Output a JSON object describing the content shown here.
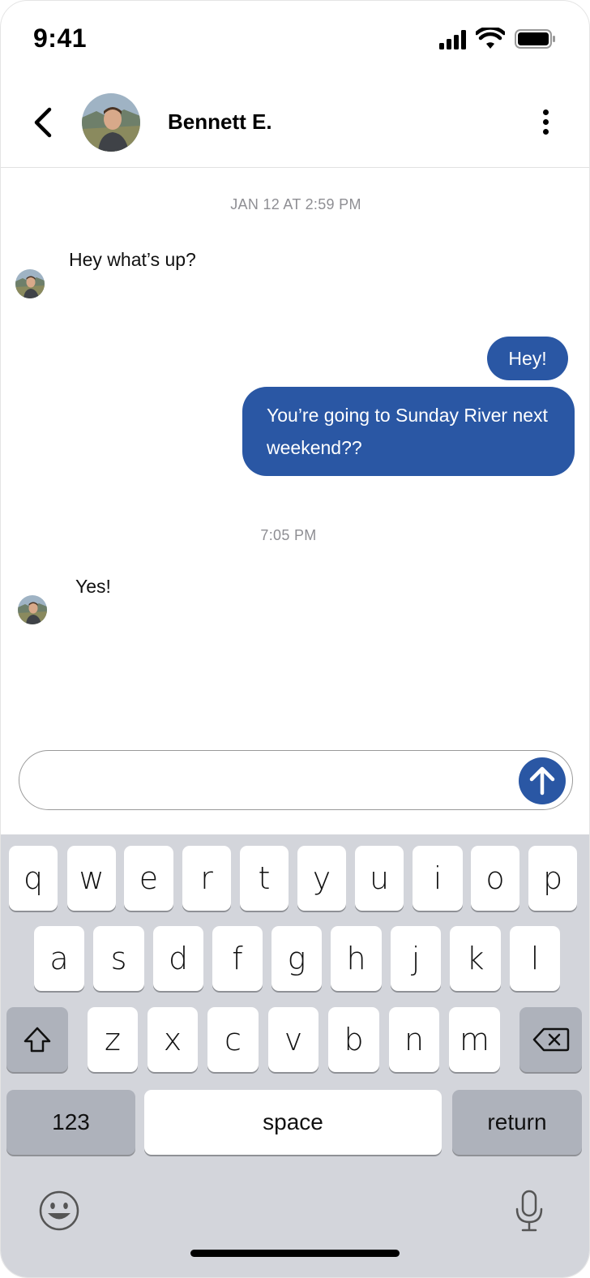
{
  "status_bar": {
    "time": "9:41"
  },
  "header": {
    "contact_name": "Bennett E."
  },
  "chat": {
    "timestamp_1": "JAN 12 AT 2:59 PM",
    "incoming_1": "Hey what’s up?",
    "outgoing_1": "Hey!",
    "outgoing_2": "You’re going to Sunday River next weekend??",
    "timestamp_2": "7:05 PM",
    "incoming_2": "Yes!"
  },
  "composer": {
    "placeholder": ""
  },
  "keyboard": {
    "row1": [
      "q",
      "w",
      "e",
      "r",
      "t",
      "y",
      "u",
      "i",
      "o",
      "p"
    ],
    "row2": [
      "a",
      "s",
      "d",
      "f",
      "g",
      "h",
      "j",
      "k",
      "l"
    ],
    "row3": [
      "z",
      "x",
      "c",
      "v",
      "b",
      "n",
      "m"
    ],
    "numbers_label": "123",
    "space_label": "space",
    "return_label": "return"
  },
  "colors": {
    "accent": "#2a57a4",
    "keyboard_bg": "#d3d5db",
    "timestamp": "#8e8e93"
  }
}
